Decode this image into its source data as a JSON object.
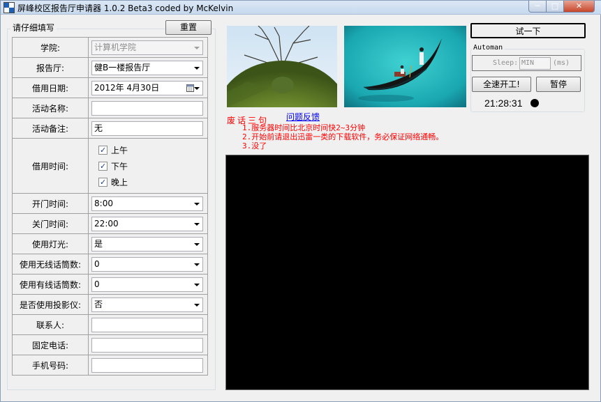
{
  "window": {
    "title": "屏峰校区报告厅申请器 1.0.2 Beta3 coded by McKelvin",
    "min": "─",
    "max": "□",
    "close": "✕"
  },
  "form": {
    "group_title": "请仔细填写",
    "reset_label": "重置",
    "college_label": "学院:",
    "college_value": "计算机学院",
    "hall_label": "报告厅:",
    "hall_value": "健B一楼报告厅",
    "date_label": "借用日期:",
    "date_value": "2012年  4月30日",
    "name_label": "活动名称:",
    "name_value": "",
    "remark_label": "活动备注:",
    "remark_value": "无",
    "time_label": "借用时间:",
    "slots": [
      {
        "label": "上午",
        "checked": true
      },
      {
        "label": "下午",
        "checked": true
      },
      {
        "label": "晚上",
        "checked": true
      }
    ],
    "open_label": "开门时间:",
    "open_value": "8:00",
    "close_label": "关门时间:",
    "close_value": "22:00",
    "light_label": "使用灯光:",
    "light_value": "是",
    "wireless_label": "使用无线话筒数:",
    "wireless_value": "0",
    "wired_label": "使用有线话筒数:",
    "wired_value": "0",
    "projector_label": "是否使用投影仪:",
    "projector_value": "否",
    "contact_label": "联系人:",
    "contact_value": "",
    "phone_label": "固定电话:",
    "phone_value": "",
    "mobile_label": "手机号码:",
    "mobile_value": ""
  },
  "controls": {
    "try_label": "试一下",
    "automan_title": "Automan",
    "sleep_label": "Sleep:",
    "sleep_value": "MIN",
    "sleep_unit": "(ms)",
    "start_label": "全速开工!",
    "pause_label": "暂停",
    "clock": "21:28:31"
  },
  "notes": {
    "title": "废话三句",
    "feedback_link": "问题反馈",
    "lines": [
      "1.服务器时间比北京时间快2~3分钟",
      "2.开始前请退出迅雷一类的下载软件，务必保证网络通畅。",
      "3.没了"
    ]
  },
  "colors": {
    "notes": "#ff0000",
    "link": "#0000ff",
    "console_bg": "#000000"
  }
}
